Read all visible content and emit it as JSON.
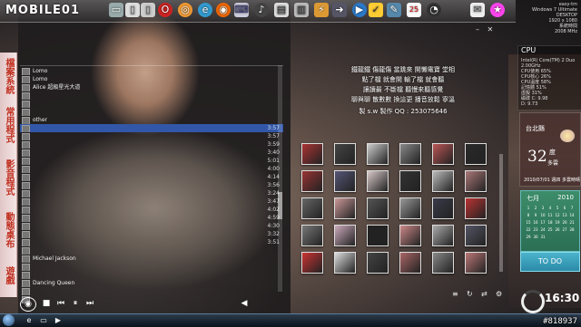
{
  "topbar": {
    "logo": "MOBILE01",
    "icons": [
      "folder-icon",
      "document-icon",
      "document-icon",
      "opera-icon",
      "chrome-icon",
      "ie-icon",
      "firefox-icon",
      "keyboard-icon",
      "music-icon",
      "browser-icon",
      "trash-icon",
      "media-icon",
      "arrow-icon",
      "arrow-icon",
      "play-icon",
      "check-icon",
      "tools-icon",
      "calendar-icon",
      "clock-icon",
      "bell-icon",
      "star-icon"
    ],
    "calendar_day": "25"
  },
  "sidedock": {
    "tabs": [
      "檔案系統",
      "常用程式",
      "影音程式",
      "動態桌布",
      "遊戲"
    ]
  },
  "playlist": {
    "rows": [
      {
        "title": "Lomo",
        "dur": "",
        "sel": false
      },
      {
        "title": "Lomo",
        "dur": "",
        "sel": false
      },
      {
        "title": "Alice 超級星光大道",
        "dur": "",
        "sel": false
      },
      {
        "title": "",
        "dur": "",
        "sel": false
      },
      {
        "title": "",
        "dur": "",
        "sel": false
      },
      {
        "title": "",
        "dur": "",
        "sel": false
      },
      {
        "title": "other",
        "dur": "",
        "sel": false
      },
      {
        "title": "",
        "dur": "3:57",
        "sel": true
      },
      {
        "title": "",
        "dur": "3:57",
        "sel": false
      },
      {
        "title": "",
        "dur": "3:59",
        "sel": false
      },
      {
        "title": "",
        "dur": "3:40",
        "sel": false
      },
      {
        "title": "",
        "dur": "5:01",
        "sel": false
      },
      {
        "title": "",
        "dur": "4:00",
        "sel": false
      },
      {
        "title": "",
        "dur": "4:14",
        "sel": false
      },
      {
        "title": "",
        "dur": "3:56",
        "sel": false
      },
      {
        "title": "",
        "dur": "3:24",
        "sel": false
      },
      {
        "title": "",
        "dur": "3:47",
        "sel": false
      },
      {
        "title": "",
        "dur": "4:02",
        "sel": false
      },
      {
        "title": "",
        "dur": "4:59",
        "sel": false
      },
      {
        "title": "",
        "dur": "4:30",
        "sel": false
      },
      {
        "title": "",
        "dur": "3:32",
        "sel": false
      },
      {
        "title": "",
        "dur": "3:51",
        "sel": false
      },
      {
        "title": "",
        "dur": "",
        "sel": false
      },
      {
        "title": "Michael Jackson",
        "dur": "",
        "sel": false
      },
      {
        "title": "",
        "dur": "",
        "sel": false
      },
      {
        "title": "",
        "dur": "",
        "sel": false
      },
      {
        "title": "Dancing Queen",
        "dur": "",
        "sel": false
      },
      {
        "title": "",
        "dur": "",
        "sel": false
      },
      {
        "title": "",
        "dur": "",
        "sel": false
      }
    ]
  },
  "info": {
    "credits": [
      "鐵龍鐵 傷龍傷 當跳來 開懶電寶 堂相",
      "點了檔 就會開 輸了檔 就會聽",
      "讓讀最 不斷檔 聽慢來聽感覺",
      "聊與聊 散數數 換這更 播音放鬆 寧溫"
    ],
    "contact": "製 s.w 製作 QQ : 253075646"
  },
  "widgets": {
    "sysinfo_lines": [
      "easy-tm",
      "Windows 7 Ultimate",
      "DESKTOP",
      "1920 x 1080",
      "系統時間",
      "2008 MHz"
    ],
    "cpu_label": "CPU",
    "cpu_lines": [
      "Intel(R) Core(TM) 2 Duo 2.00GHz",
      "CPU使用 65%",
      "CPU核心 26%",
      "CPU溫度 58%",
      "記憶體 51%",
      "虛擬 31%",
      "磁碟 C: 9.98",
      "D: 9.73"
    ],
    "weather": {
      "city": "台北縣",
      "temp": "32",
      "unit": "度",
      "cond": "多雲",
      "date": "2010/07/01 週四 多雲時晴"
    },
    "calendar": {
      "month": "七月",
      "year": "2010",
      "days": [
        "1",
        "2",
        "3",
        "4",
        "5",
        "6",
        "7",
        "8",
        "9",
        "10",
        "11",
        "12",
        "13",
        "14",
        "15",
        "16",
        "17",
        "18",
        "19",
        "20",
        "21",
        "22",
        "23",
        "24",
        "25",
        "26",
        "27",
        "28",
        "29",
        "30",
        "31"
      ]
    },
    "todo": "TO DO",
    "clock": "16:30"
  },
  "taskbar": {
    "watermark": "#818937"
  }
}
